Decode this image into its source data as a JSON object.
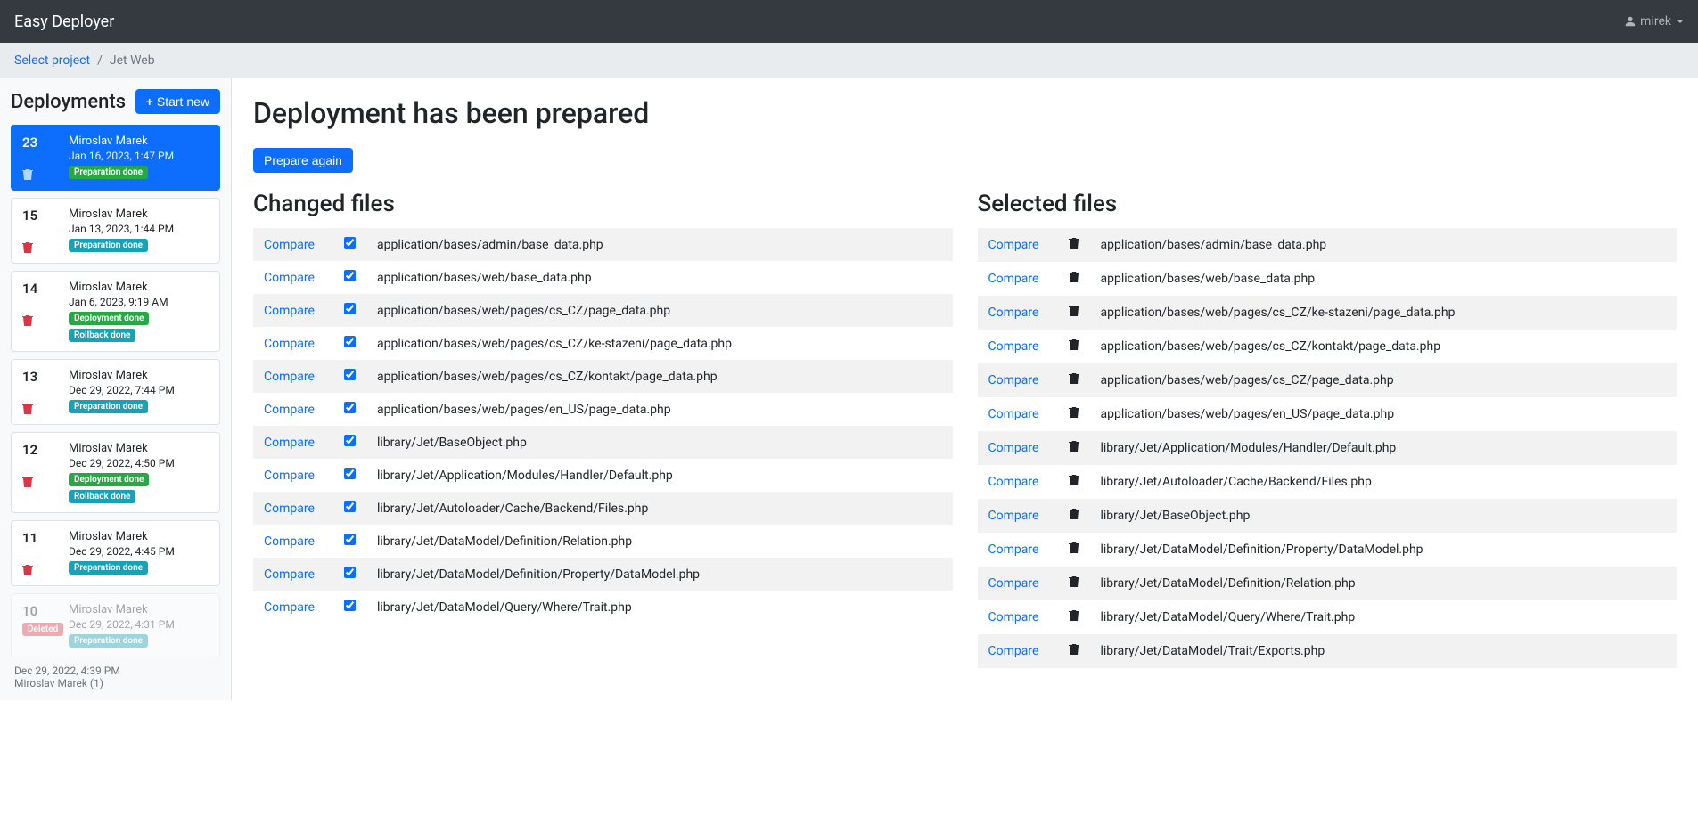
{
  "navbar": {
    "brand": "Easy Deployer",
    "user": "mirek"
  },
  "breadcrumb": {
    "link": "Select project",
    "current": "Jet Web"
  },
  "sidebar": {
    "title": "Deployments",
    "startBtn": "Start new",
    "items": [
      {
        "num": "23",
        "author": "Miroslav Marek",
        "date": "Jan 16, 2023, 1:47 PM",
        "badges": [
          {
            "text": "Preparation done",
            "cls": "badge-green"
          }
        ],
        "active": true
      },
      {
        "num": "15",
        "author": "Miroslav Marek",
        "date": "Jan 13, 2023, 1:44 PM",
        "badges": [
          {
            "text": "Preparation done",
            "cls": "badge-teal"
          }
        ]
      },
      {
        "num": "14",
        "author": "Miroslav Marek",
        "date": "Jan 6, 2023, 9:19 AM",
        "badges": [
          {
            "text": "Deployment done",
            "cls": "badge-green"
          },
          {
            "text": "Rollback done",
            "cls": "badge-teal"
          }
        ]
      },
      {
        "num": "13",
        "author": "Miroslav Marek",
        "date": "Dec 29, 2022, 7:44 PM",
        "badges": [
          {
            "text": "Preparation done",
            "cls": "badge-teal"
          }
        ]
      },
      {
        "num": "12",
        "author": "Miroslav Marek",
        "date": "Dec 29, 2022, 4:50 PM",
        "badges": [
          {
            "text": "Deployment done",
            "cls": "badge-green"
          },
          {
            "text": "Rollback done",
            "cls": "badge-teal"
          }
        ]
      },
      {
        "num": "11",
        "author": "Miroslav Marek",
        "date": "Dec 29, 2022, 4:45 PM",
        "badges": [
          {
            "text": "Preparation done",
            "cls": "badge-teal"
          }
        ]
      },
      {
        "num": "10",
        "author": "Miroslav Marek",
        "date": "Dec 29, 2022, 4:31 PM",
        "badges": [
          {
            "text": "Preparation done",
            "cls": "badge-teal"
          }
        ],
        "deleted": true,
        "delBadge": "Deleted",
        "extraDate": "Dec 29, 2022, 4:39 PM",
        "extraAuthor": "Miroslav Marek (1)"
      }
    ]
  },
  "main": {
    "title": "Deployment has been prepared",
    "prepareBtn": "Prepare again",
    "changedTitle": "Changed files",
    "selectedTitle": "Selected files",
    "compareLabel": "Compare",
    "changedFiles": [
      "application/bases/admin/base_data.php",
      "application/bases/web/base_data.php",
      "application/bases/web/pages/cs_CZ/page_data.php",
      "application/bases/web/pages/cs_CZ/ke-stazeni/page_data.php",
      "application/bases/web/pages/cs_CZ/kontakt/page_data.php",
      "application/bases/web/pages/en_US/page_data.php",
      "library/Jet/BaseObject.php",
      "library/Jet/Application/Modules/Handler/Default.php",
      "library/Jet/Autoloader/Cache/Backend/Files.php",
      "library/Jet/DataModel/Definition/Relation.php",
      "library/Jet/DataModel/Definition/Property/DataModel.php",
      "library/Jet/DataModel/Query/Where/Trait.php"
    ],
    "selectedFiles": [
      "application/bases/admin/base_data.php",
      "application/bases/web/base_data.php",
      "application/bases/web/pages/cs_CZ/ke-stazeni/page_data.php",
      "application/bases/web/pages/cs_CZ/kontakt/page_data.php",
      "application/bases/web/pages/cs_CZ/page_data.php",
      "application/bases/web/pages/en_US/page_data.php",
      "library/Jet/Application/Modules/Handler/Default.php",
      "library/Jet/Autoloader/Cache/Backend/Files.php",
      "library/Jet/BaseObject.php",
      "library/Jet/DataModel/Definition/Property/DataModel.php",
      "library/Jet/DataModel/Definition/Relation.php",
      "library/Jet/DataModel/Query/Where/Trait.php",
      "library/Jet/DataModel/Trait/Exports.php"
    ]
  }
}
